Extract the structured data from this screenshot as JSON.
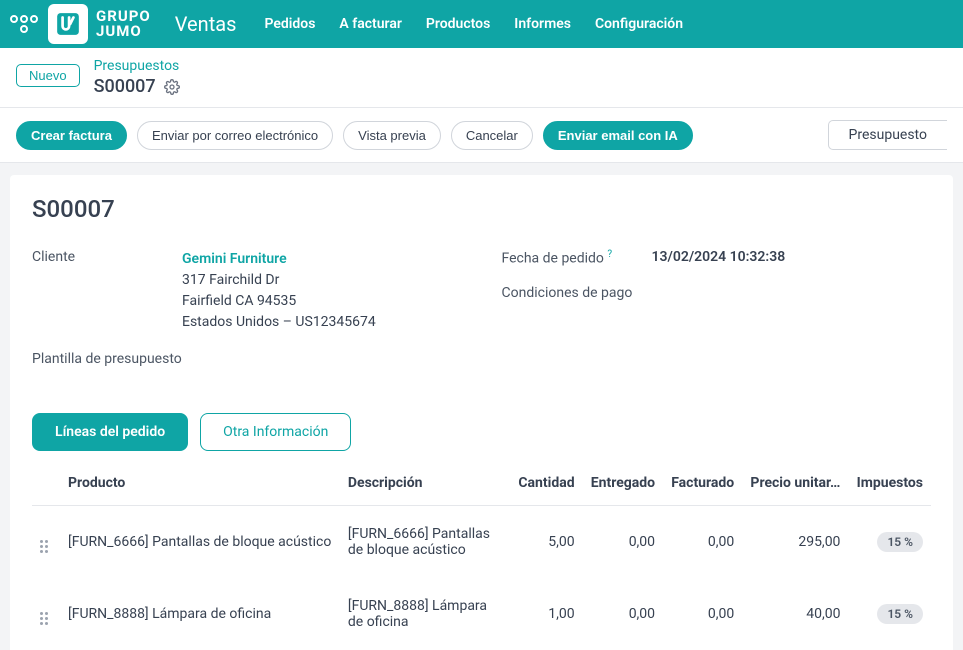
{
  "topbar": {
    "brand_line1": "GRUPO",
    "brand_line2": "JUMO",
    "module": "Ventas",
    "menu": [
      "Pedidos",
      "A facturar",
      "Productos",
      "Informes",
      "Configuración"
    ]
  },
  "crumbs": {
    "new_btn": "Nuevo",
    "parent": "Presupuestos",
    "title": "S00007"
  },
  "actions": {
    "create_invoice": "Crear factura",
    "send_email": "Enviar por correo electrónico",
    "preview": "Vista previa",
    "cancel": "Cancelar",
    "send_ai": "Enviar email con IA",
    "status": "Presupuesto"
  },
  "doc": {
    "title": "S00007",
    "client_label": "Cliente",
    "client_name": "Gemini Furniture",
    "client_addr1": "317 Fairchild Dr",
    "client_addr2": "Fairfield CA 94535",
    "client_addr3": "Estados Unidos – US12345674",
    "quote_tmpl_label": "Plantilla de presupuesto",
    "order_date_label": "Fecha de pedido",
    "order_date": "13/02/2024 10:32:38",
    "pay_terms_label": "Condiciones de pago"
  },
  "tabs": {
    "lines": "Líneas del pedido",
    "other": "Otra Información"
  },
  "table": {
    "cols": {
      "product": "Producto",
      "desc": "Descripción",
      "qty": "Cantidad",
      "delivered": "Entregado",
      "invoiced": "Facturado",
      "price": "Precio unitar…",
      "taxes": "Impuestos"
    },
    "rows": [
      {
        "product": "[FURN_6666] Pantallas de bloque acústico",
        "desc": "[FURN_6666] Pantallas de bloque acústico",
        "qty": "5,00",
        "delivered": "0,00",
        "invoiced": "0,00",
        "price": "295,00",
        "tax": "15 %"
      },
      {
        "product": "[FURN_8888] Lámpara de oficina",
        "desc": "[FURN_8888] Lámpara de oficina",
        "qty": "1,00",
        "delivered": "0,00",
        "invoiced": "0,00",
        "price": "40,00",
        "tax": "15 %"
      }
    ]
  }
}
